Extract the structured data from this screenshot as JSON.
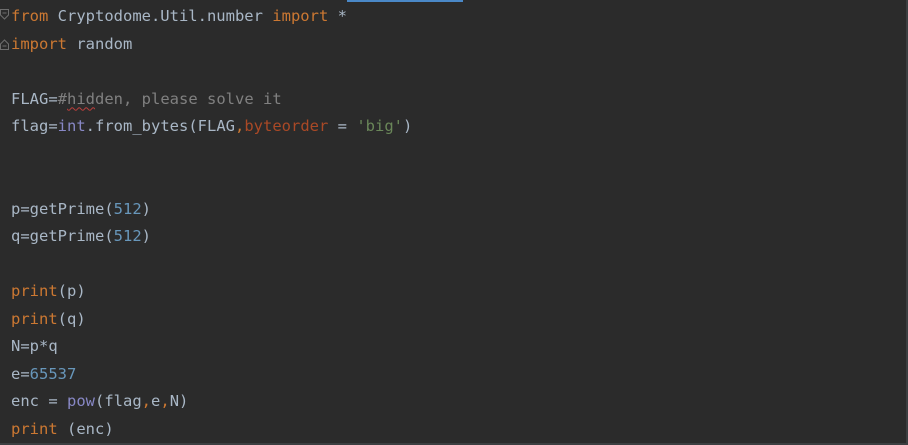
{
  "editor": {
    "lines": [
      [
        {
          "text": "from",
          "cls": "kw"
        },
        {
          "text": " Cryptodome.Util.number ",
          "cls": "plain"
        },
        {
          "text": "import",
          "cls": "kw"
        },
        {
          "text": " *",
          "cls": "plain"
        }
      ],
      [
        {
          "text": "import",
          "cls": "kw"
        },
        {
          "text": " random",
          "cls": "plain"
        }
      ],
      [],
      [
        {
          "text": "FLAG=",
          "cls": "plain"
        },
        {
          "text": "#hidden, please solve it",
          "cls": "comment"
        }
      ],
      [
        {
          "text": "flag=",
          "cls": "plain"
        },
        {
          "text": "int",
          "cls": "builtin"
        },
        {
          "text": ".from_bytes(FLAG",
          "cls": "plain"
        },
        {
          "text": ",",
          "cls": "comma"
        },
        {
          "text": "byteorder",
          "cls": "param"
        },
        {
          "text": " = ",
          "cls": "plain"
        },
        {
          "text": "'big'",
          "cls": "str"
        },
        {
          "text": ")",
          "cls": "plain"
        }
      ],
      [],
      [],
      [
        {
          "text": "p=getPrime(",
          "cls": "plain"
        },
        {
          "text": "512",
          "cls": "num"
        },
        {
          "text": ")",
          "cls": "plain"
        }
      ],
      [
        {
          "text": "q=getPrime(",
          "cls": "plain"
        },
        {
          "text": "512",
          "cls": "num"
        },
        {
          "text": ")",
          "cls": "plain"
        }
      ],
      [],
      [
        {
          "text": "print",
          "cls": "kw"
        },
        {
          "text": "(p)",
          "cls": "plain"
        }
      ],
      [
        {
          "text": "print",
          "cls": "kw"
        },
        {
          "text": "(q)",
          "cls": "plain"
        }
      ],
      [
        {
          "text": "N=p*q",
          "cls": "plain"
        }
      ],
      [
        {
          "text": "e=",
          "cls": "plain"
        },
        {
          "text": "65537",
          "cls": "num"
        }
      ],
      [
        {
          "text": "enc = ",
          "cls": "plain"
        },
        {
          "text": "pow",
          "cls": "builtin"
        },
        {
          "text": "(flag",
          "cls": "plain"
        },
        {
          "text": ",",
          "cls": "comma"
        },
        {
          "text": "e",
          "cls": "plain"
        },
        {
          "text": ",",
          "cls": "comma"
        },
        {
          "text": "N)",
          "cls": "plain"
        }
      ],
      [
        {
          "text": "print",
          "cls": "kw"
        },
        {
          "text": " (enc)",
          "cls": "plain"
        }
      ]
    ]
  },
  "colors": {
    "background": "#2b2b2b",
    "keyword": "#cc7832",
    "default_text": "#a9b7c6",
    "comment": "#808080",
    "builtin": "#8888c6",
    "number": "#6897bb",
    "parameter": "#aa4926",
    "string": "#6a8759",
    "accent": "#4a88c7"
  },
  "icons": {
    "fold_open": "fold-open-icon",
    "fold_close": "fold-close-icon"
  }
}
